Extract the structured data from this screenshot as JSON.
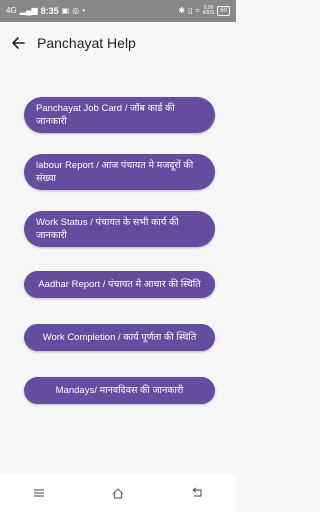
{
  "status_bar": {
    "network_left": "4G",
    "time": "8:35",
    "indicator_icons": [
      "screenshot-icon",
      "whatsapp-icon",
      "dot"
    ],
    "net_speed_value": "0.00",
    "net_speed_unit": "KB/S",
    "battery": "60"
  },
  "app_bar": {
    "title": "Panchayat Help"
  },
  "menu": {
    "items": [
      {
        "label": "Panchayat Job Card / जॉब कार्ड की जानकारी"
      },
      {
        "label": "labour Report / आज पंचायत मे मजदूरों की संख्या"
      },
      {
        "label": "Work Status / पंचायत के सभी कार्य की जानकारी"
      },
      {
        "label": "Aadhar Report / पंचायत मे आधार की स्थिति"
      },
      {
        "label": "Work Completion / कार्य पूर्णता की स्थिति"
      },
      {
        "label": "Mandays/ मानवदिवस की जानकारी"
      }
    ]
  },
  "colors": {
    "button": "#654c9f",
    "status_bar": "#888888"
  }
}
